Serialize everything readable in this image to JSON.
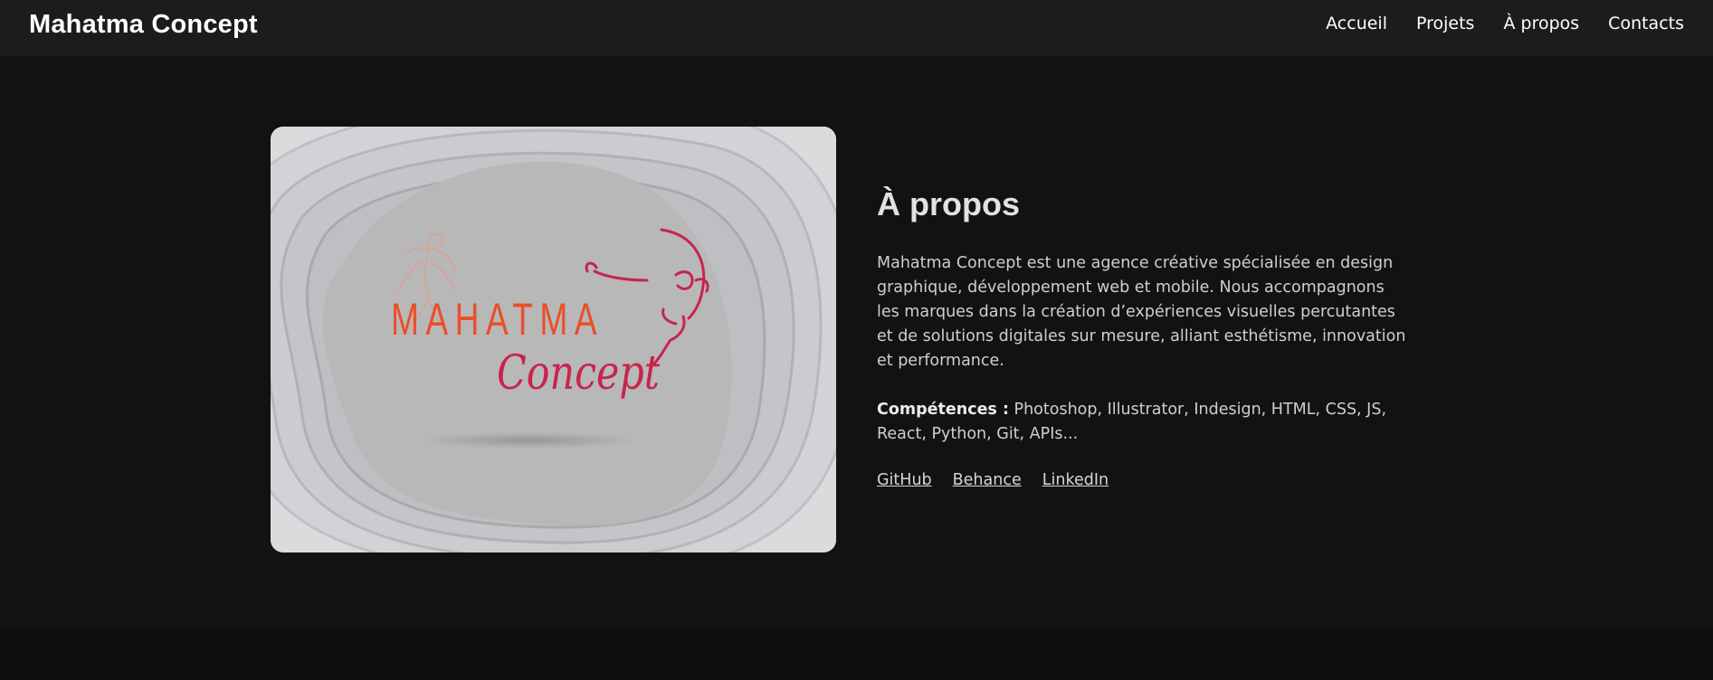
{
  "header": {
    "brand": "Mahatma Concept",
    "nav": [
      "Accueil",
      "Projets",
      "À propos",
      "Contacts"
    ]
  },
  "about": {
    "image_wordmark": "MAHATMA",
    "image_script": "Concept",
    "title": "À propos",
    "description": "Mahatma Concept est une agence créative spécialisée en design graphique, développement web et mobile. Nous accompagnons les marques dans la création d’expériences visuelles percutantes et de solutions digitales sur mesure, alliant esthétisme, innovation et performance.",
    "skills_label": "Compétences :",
    "skills_value": "Photoshop, Illustrator, Indesign, HTML, CSS, JS, React, Python, Git, APIs...",
    "links": [
      "GitHub",
      "Behance",
      "LinkedIn"
    ]
  },
  "colors": {
    "background": "#121212",
    "header_bg": "#1c1c1c",
    "logo_orange": "#e8502a",
    "logo_crimson": "#c8244d"
  }
}
